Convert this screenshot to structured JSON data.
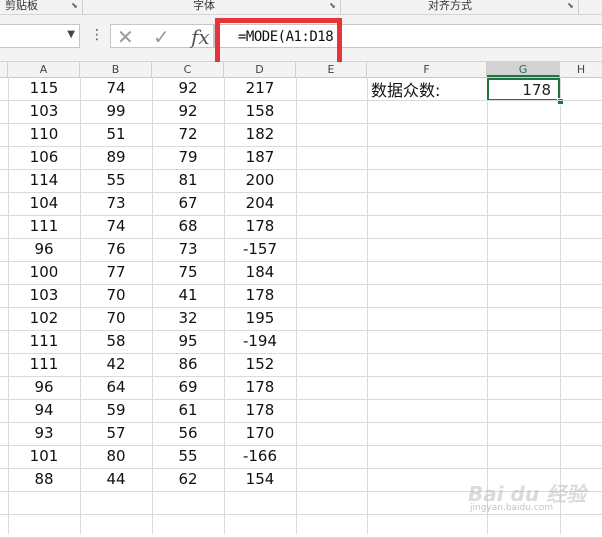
{
  "ribbon": {
    "groups": [
      "剪贴板",
      "字体",
      "对齐方式"
    ]
  },
  "formula_bar": {
    "formula": "=MODE(A1:D18"
  },
  "columns": [
    "A",
    "B",
    "C",
    "D",
    "E",
    "F",
    "G",
    "H"
  ],
  "rows": [
    [
      115,
      74,
      92,
      217
    ],
    [
      103,
      99,
      92,
      158
    ],
    [
      110,
      51,
      72,
      182
    ],
    [
      106,
      89,
      79,
      187
    ],
    [
      114,
      55,
      81,
      200
    ],
    [
      104,
      73,
      67,
      204
    ],
    [
      111,
      74,
      68,
      178
    ],
    [
      96,
      76,
      73,
      -157
    ],
    [
      100,
      77,
      75,
      184
    ],
    [
      103,
      70,
      41,
      178
    ],
    [
      102,
      70,
      32,
      195
    ],
    [
      111,
      58,
      95,
      -194
    ],
    [
      111,
      42,
      86,
      152
    ],
    [
      96,
      64,
      69,
      178
    ],
    [
      94,
      59,
      61,
      178
    ],
    [
      93,
      57,
      56,
      170
    ],
    [
      101,
      80,
      55,
      -166
    ],
    [
      88,
      44,
      62,
      154
    ]
  ],
  "result": {
    "label": "数据众数:",
    "value": "178"
  },
  "watermark": {
    "text": "Bai du 经验",
    "sub": "jingyan.baidu.com"
  },
  "colors": {
    "highlight_box": "#e8333a",
    "selection": "#217346"
  }
}
